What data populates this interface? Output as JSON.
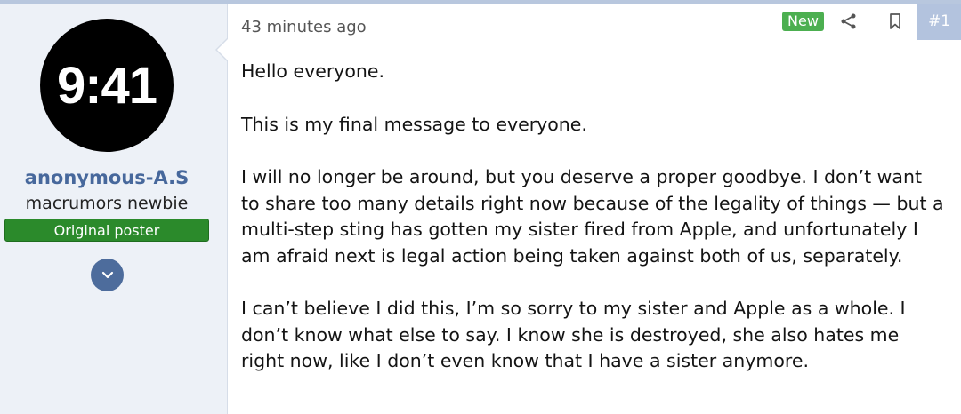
{
  "user": {
    "avatar_text": "9:41",
    "username": "anonymous-A.S",
    "title": "macrumors newbie",
    "badge": "Original poster"
  },
  "post": {
    "timestamp": "43 minutes ago",
    "new_badge": "New",
    "post_number": "#1",
    "paragraphs": [
      "Hello everyone.",
      "This is my final message to everyone.",
      "I will no longer be around, but you deserve a proper goodbye. I don’t want to share too many details right now because of the legality of things — but a multi-step sting has gotten my sister fired from Apple, and unfortunately I am afraid next is legal action being taken against both of us, separately.",
      "I can’t believe I did this, I’m so sorry to my sister and Apple as a whole. I don’t know what else to say. I know she is destroyed, she also hates me right now, like I don’t even know that I have a sister anymore."
    ]
  },
  "icons": {
    "share": "share-icon",
    "bookmark": "bookmark-icon",
    "expand": "chevron-down-icon"
  },
  "colors": {
    "username": "#47689c",
    "badge_green": "#2b8a2b",
    "new_green": "#4caf50",
    "post_number_bg": "#b3c3de"
  }
}
